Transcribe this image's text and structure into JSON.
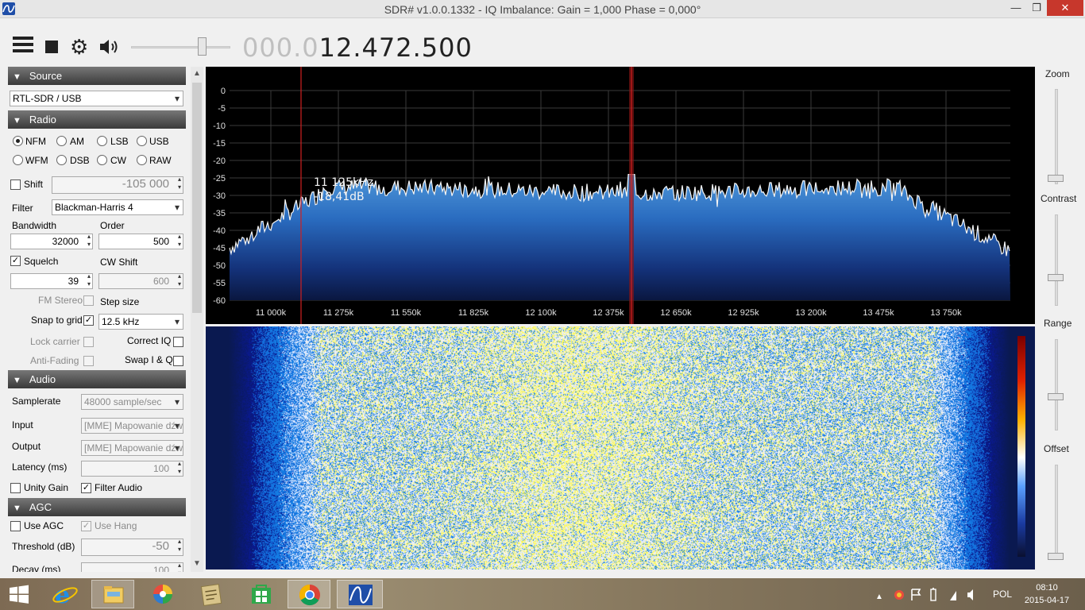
{
  "window": {
    "title": "SDR# v1.0.0.1332 - IQ Imbalance: Gain = 1,000 Phase = 0,000°"
  },
  "toolbar": {
    "frequency_dim": "000.0",
    "frequency_bright": "12.472.500"
  },
  "source": {
    "header": "Source",
    "device": "RTL-SDR / USB"
  },
  "radio": {
    "header": "Radio",
    "modes": [
      "NFM",
      "AM",
      "LSB",
      "USB",
      "WFM",
      "DSB",
      "CW",
      "RAW"
    ],
    "selected_mode": "NFM",
    "shift_label": "Shift",
    "shift_value": "-105 000",
    "filter_label": "Filter",
    "filter_value": "Blackman-Harris 4",
    "bandwidth_label": "Bandwidth",
    "bandwidth_value": "32000",
    "order_label": "Order",
    "order_value": "500",
    "squelch_label": "Squelch",
    "squelch_value": "39",
    "cwshift_label": "CW Shift",
    "cwshift_value": "600",
    "fmstereo_label": "FM Stereo",
    "stepsize_label": "Step size",
    "snap_label": "Snap to grid",
    "snap_value": "12.5 kHz",
    "lockcarrier_label": "Lock carrier",
    "correctiq_label": "Correct IQ",
    "antifading_label": "Anti-Fading",
    "swapiq_label": "Swap I & Q"
  },
  "audio": {
    "header": "Audio",
    "samplerate_label": "Samplerate",
    "samplerate_value": "48000 sample/sec",
    "input_label": "Input",
    "input_value": "[MME] Mapowanie dźw",
    "output_label": "Output",
    "output_value": "[MME] Mapowanie dźw",
    "latency_label": "Latency (ms)",
    "latency_value": "100",
    "unitygain_label": "Unity Gain",
    "filteraudio_label": "Filter Audio"
  },
  "agc": {
    "header": "AGC",
    "useagc_label": "Use AGC",
    "usehang_label": "Use Hang",
    "threshold_label": "Threshold (dB)",
    "threshold_value": "-50",
    "decay_label": "Decay (ms)",
    "decay_value": "100"
  },
  "right_controls": {
    "zoom": "Zoom",
    "contrast": "Contrast",
    "range": "Range",
    "offset": "Offset"
  },
  "spectrum": {
    "y_ticks": [
      "0",
      "-5",
      "-10",
      "-15",
      "-20",
      "-25",
      "-30",
      "-35",
      "-40",
      "-45",
      "-50",
      "-55",
      "-60"
    ],
    "x_ticks": [
      "11 000k",
      "11 275k",
      "11 550k",
      "11 825k",
      "12 100k",
      "12 375k",
      "12 650k",
      "12 925k",
      "13 200k",
      "13 475k",
      "13 750k"
    ],
    "cursor_freq": "11 125kHz",
    "cursor_level": "-18,41dB"
  },
  "taskbar": {
    "lang": "POL",
    "time": "08:10",
    "date": "2015-04-17"
  },
  "colors": {
    "spectrum_fill": "#2a6cc0",
    "waterfall_base": "#0a1a4a",
    "filter_band": "#b02020",
    "title_close": "#c7372c"
  }
}
